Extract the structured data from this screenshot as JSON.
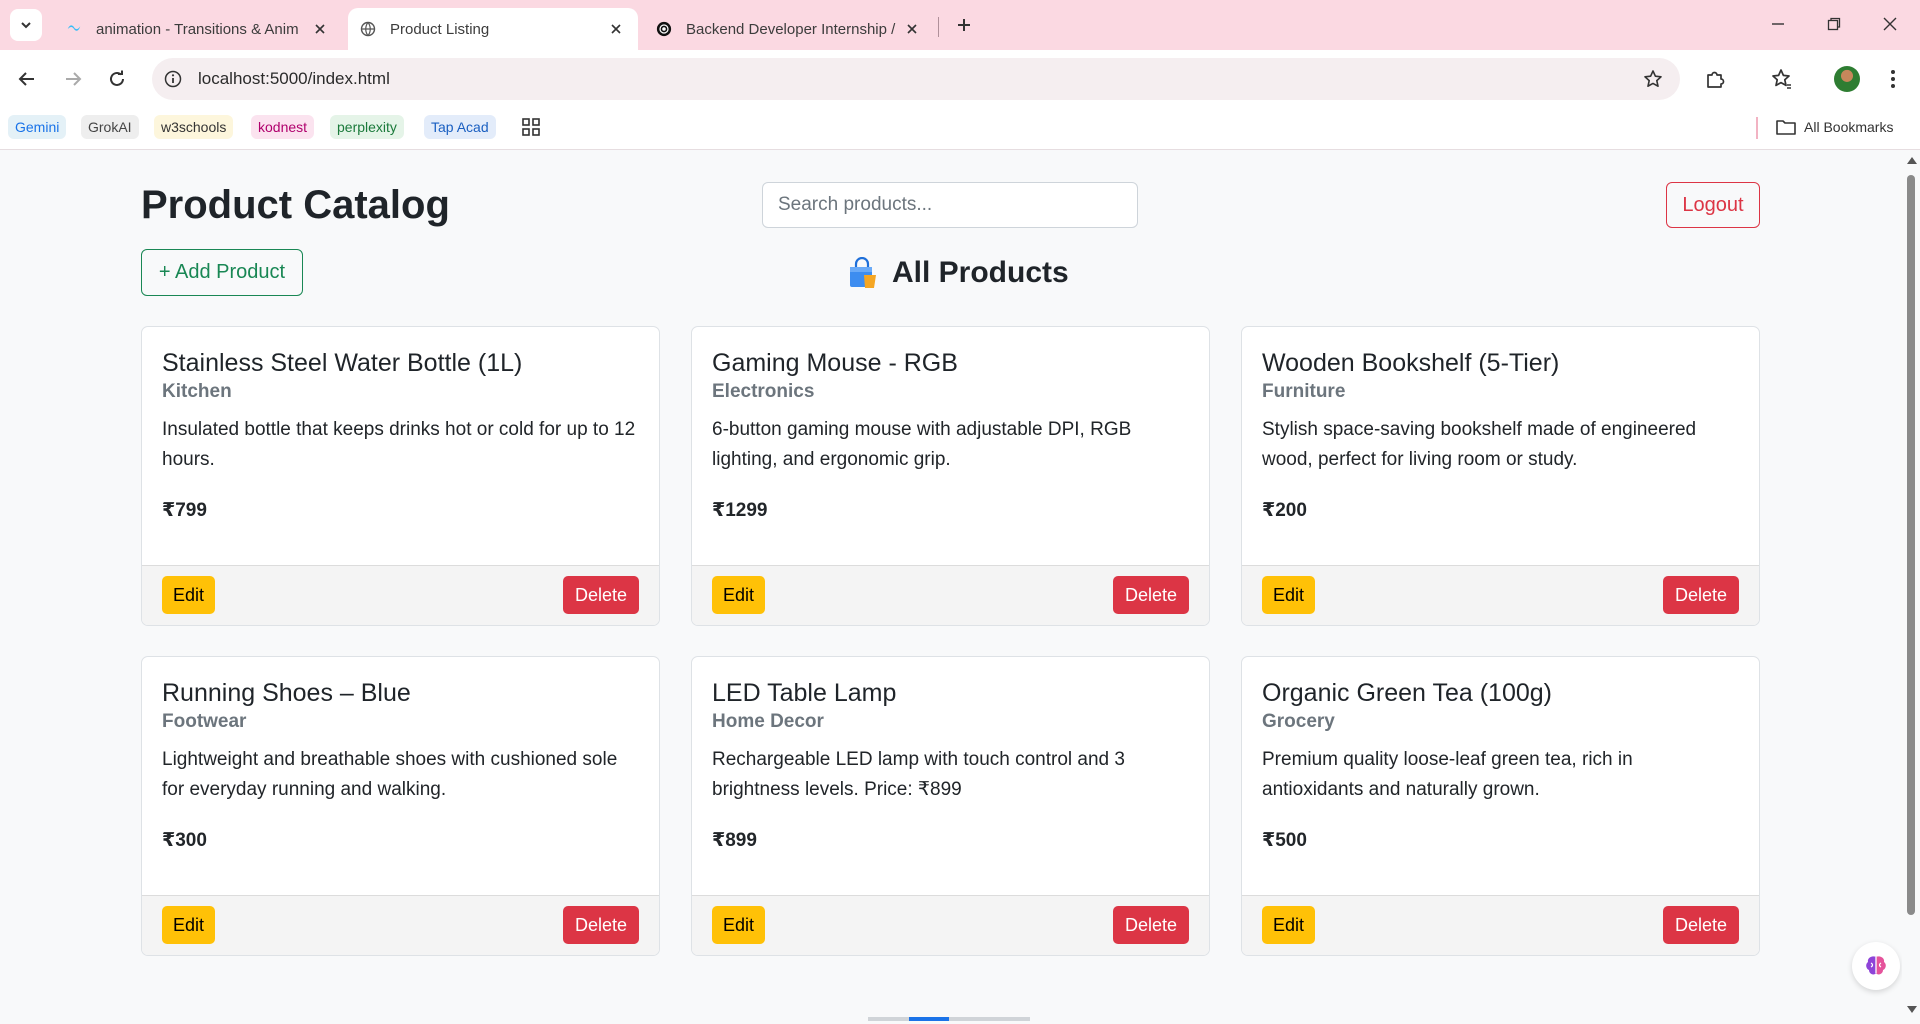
{
  "browser": {
    "tabs": [
      {
        "title": "animation - Transitions & Anim",
        "favicon": "tailwind-icon",
        "active": false
      },
      {
        "title": "Product Listing",
        "favicon": "globe-icon",
        "active": true
      },
      {
        "title": "Backend Developer Internship / A",
        "favicon": "openai-icon",
        "active": false
      }
    ],
    "url": "localhost:5000/index.html",
    "bookmarks": [
      {
        "label": "Gemini",
        "color": "#1a73e8",
        "bg": "#e4f1f7"
      },
      {
        "label": "GrokAI",
        "color": "#444444",
        "bg": "#eeeeee"
      },
      {
        "label": "w3schools",
        "color": "#333333",
        "bg": "#fdf6dc"
      },
      {
        "label": "kodnest",
        "color": "#b0006d",
        "bg": "#fbe3ef"
      },
      {
        "label": "perplexity",
        "color": "#1b7a3b",
        "bg": "#e5f4e8"
      },
      {
        "label": "Tap Acad",
        "color": "#1a5fc1",
        "bg": "#e3ecfa"
      }
    ],
    "all_bookmarks_label": "All Bookmarks",
    "colors": {
      "tab_strip": "#fbd9e2",
      "omnibox": "#f5eef0"
    }
  },
  "page": {
    "title": "Product Catalog",
    "search_placeholder": "Search products...",
    "logout_label": "Logout",
    "add_product_label": "+ Add Product",
    "section_heading": "All Products",
    "section_icon": "shopping-bag-icon",
    "edit_label": "Edit",
    "delete_label": "Delete",
    "colors": {
      "edit": "#ffc107",
      "delete": "#dc3545",
      "add": "#198754",
      "logout": "#dc3545"
    }
  },
  "products": [
    {
      "name": "Stainless Steel Water Bottle (1L)",
      "category": "Kitchen",
      "description": "Insulated bottle that keeps drinks hot or cold for up to 12 hours.",
      "price": "₹799"
    },
    {
      "name": "Gaming Mouse - RGB",
      "category": "Electronics",
      "description": "6-button gaming mouse with adjustable DPI, RGB lighting, and ergonomic grip.",
      "price": "₹1299"
    },
    {
      "name": "Wooden Bookshelf (5-Tier)",
      "category": "Furniture",
      "description": "Stylish space-saving bookshelf made of engineered wood, perfect for living room or study.",
      "price": "₹200"
    },
    {
      "name": "Running Shoes – Blue",
      "category": "Footwear",
      "description": "Lightweight and breathable shoes with cushioned sole for everyday running and walking.",
      "price": "₹300"
    },
    {
      "name": "LED Table Lamp",
      "category": "Home Decor",
      "description": "Rechargeable LED lamp with touch control and 3 brightness levels. Price: ₹899",
      "price": "₹899"
    },
    {
      "name": "Organic Green Tea (100g)",
      "category": "Grocery",
      "description": "Premium quality loose-leaf green tea, rich in antioxidants and naturally grown.",
      "price": "₹500"
    }
  ]
}
